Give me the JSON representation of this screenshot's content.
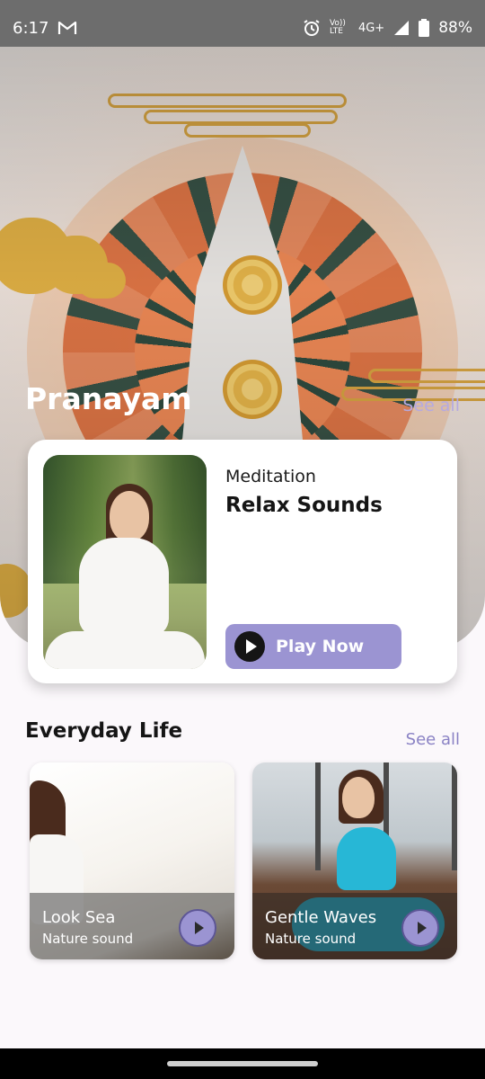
{
  "status_bar": {
    "time": "6:17",
    "mail_icon": "gmail-icon",
    "volte": "Vo)) LTE",
    "network": "4G+",
    "battery": "88%"
  },
  "hero": {
    "title": "Pranayam",
    "see_all": "See all"
  },
  "featured": {
    "category": "Meditation",
    "name": "Relax Sounds",
    "play_label": "Play Now"
  },
  "everyday": {
    "title": "Everyday Life",
    "see_all": "See all",
    "items": [
      {
        "name": "Look Sea",
        "subtitle": "Nature sound"
      },
      {
        "name": "Gentle Waves",
        "subtitle": "Nature sound"
      }
    ]
  },
  "colors": {
    "accent": "#9b94d2",
    "see_all": "#8a82c4"
  }
}
